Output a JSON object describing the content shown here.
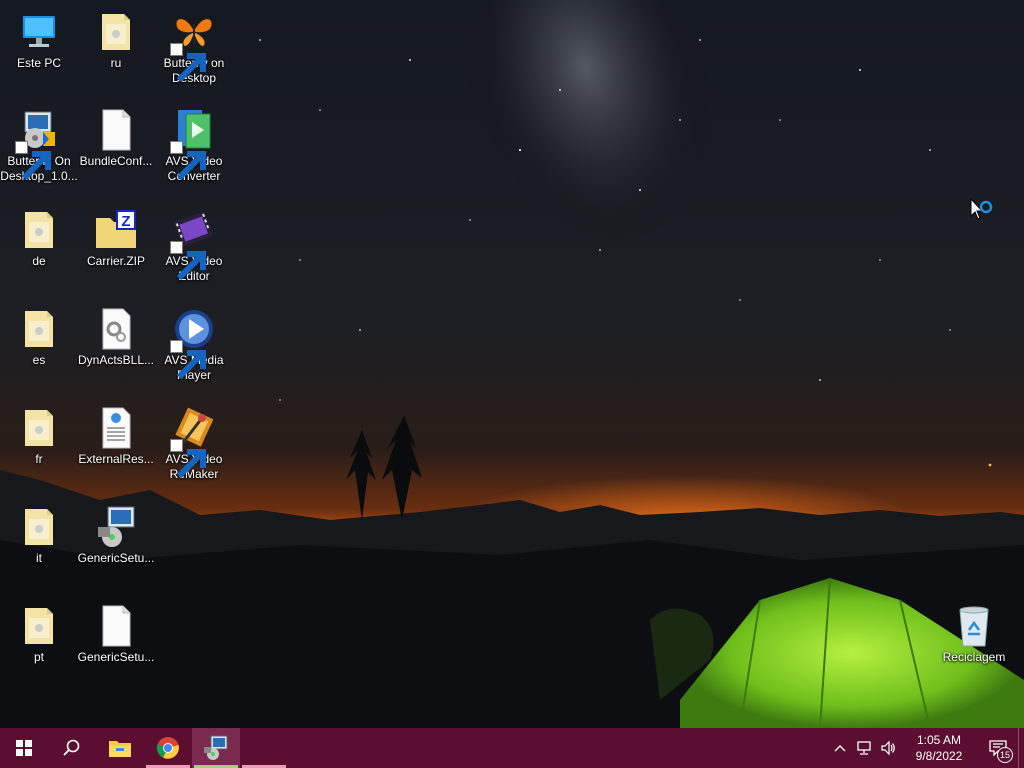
{
  "desktop": {
    "icons": [
      {
        "label": "Este PC",
        "icon": "computer-icon"
      },
      {
        "label": "ru",
        "icon": "folder-icon"
      },
      {
        "label": "Butterfly on Desktop",
        "icon": "butterfly-icon"
      },
      {
        "label": "Butterfly On Desktop_1.0...",
        "icon": "installer-icon"
      },
      {
        "label": "BundleConf...",
        "icon": "file-icon"
      },
      {
        "label": "AVS Video Converter",
        "icon": "avs-video-converter-icon"
      },
      {
        "label": "de",
        "icon": "folder-icon"
      },
      {
        "label": "Carrier.ZIP",
        "icon": "zip-folder-icon"
      },
      {
        "label": "AVS Video Editor",
        "icon": "avs-video-editor-icon"
      },
      {
        "label": "es",
        "icon": "folder-icon"
      },
      {
        "label": "DynActsBLL...",
        "icon": "config-file-icon"
      },
      {
        "label": "AVS Media Player",
        "icon": "avs-media-player-icon"
      },
      {
        "label": "fr",
        "icon": "folder-icon"
      },
      {
        "label": "ExternalRes...",
        "icon": "html-document-icon"
      },
      {
        "label": "AVS Video ReMaker",
        "icon": "avs-video-remaker-icon"
      },
      {
        "label": "it",
        "icon": "folder-icon"
      },
      {
        "label": "GenericSetu...",
        "icon": "setup-program-icon"
      },
      {
        "label": "pt",
        "icon": "folder-icon"
      },
      {
        "label": "GenericSetu...",
        "icon": "file-icon"
      },
      {
        "label": "Reciclagem",
        "icon": "recycle-bin-icon"
      }
    ]
  },
  "taskbar": {
    "buttons": [
      {
        "name": "start-button",
        "icon": "windows-logo-icon"
      },
      {
        "name": "search-button",
        "icon": "search-icon"
      },
      {
        "name": "file-explorer-button",
        "icon": "folder-icon"
      },
      {
        "name": "chrome-button",
        "icon": "chrome-icon"
      },
      {
        "name": "setup-app-button",
        "icon": "installer-icon"
      }
    ],
    "tray": {
      "icons": [
        "chevron-up-icon",
        "network-icon",
        "volume-icon"
      ],
      "time": "1:05 AM",
      "date": "9/8/2022",
      "notification_count": "15"
    },
    "colors": {
      "taskbar": "#5b0e2f",
      "active": "#7a2a4c",
      "underline": "#f09ab8"
    }
  }
}
